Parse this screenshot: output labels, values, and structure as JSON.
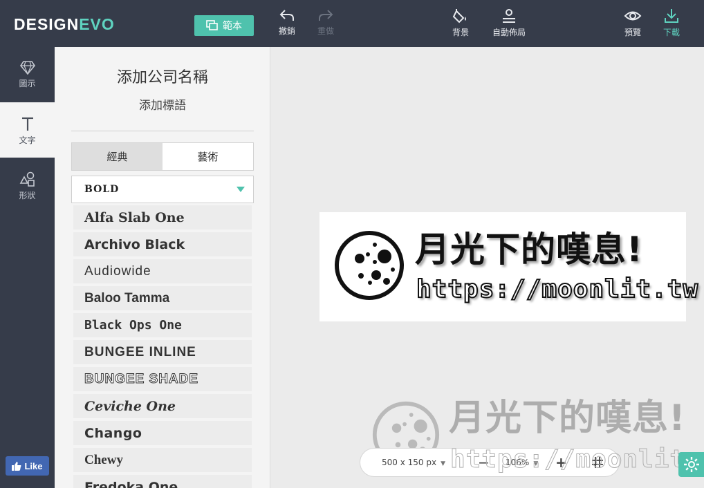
{
  "header": {
    "logo_design": "DESIGN",
    "logo_evo": "EVO",
    "template_label": "範本",
    "undo_label": "撤銷",
    "redo_label": "重做",
    "background_label": "背景",
    "auto_layout_label": "自動佈局",
    "preview_label": "預覽",
    "download_label": "下載"
  },
  "sidebar": {
    "items": [
      {
        "label": "圖示",
        "icon": "diamond-icon"
      },
      {
        "label": "文字",
        "icon": "text-icon"
      },
      {
        "label": "形狀",
        "icon": "shapes-icon"
      }
    ],
    "fb_like": "Like"
  },
  "panel": {
    "add_company": "添加公司名稱",
    "add_slogan": "添加標語",
    "tabs": [
      "經典",
      "藝術"
    ],
    "active_tab": "經典",
    "dropdown_value": "BOLD",
    "fonts": [
      "Alfa Slab One",
      "Archivo Black",
      "Audiowide",
      "Baloo Tamma",
      "Black Ops One",
      "BUNGEE INLINE",
      "BUNGEE SHADE",
      "Ceviche One",
      "Chango",
      "Chewy",
      "Fredoka One"
    ]
  },
  "canvas": {
    "title": "月光下的嘆息!",
    "url": "https://moonlit.tw",
    "size": "500 x 150 px",
    "zoom": "106%"
  },
  "colors": {
    "topbar": "#363c4a",
    "accent": "#4fc2ad",
    "facebook": "#4267b2"
  }
}
